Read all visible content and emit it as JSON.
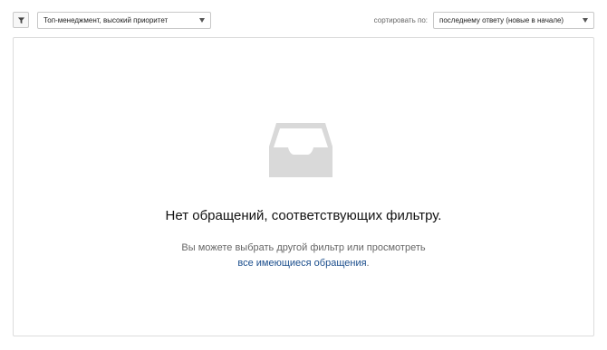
{
  "toolbar": {
    "filter_icon": "funnel-icon",
    "filter_select": {
      "value": "Топ-менеджмент, высокий приоритет"
    },
    "sort_label": "сортировать по:",
    "sort_select": {
      "value": "последнему ответу (новые в начале)"
    }
  },
  "empty_state": {
    "icon": "inbox-tray-icon",
    "title": "Нет обращений, соответствующих фильтру.",
    "text": "Вы можете выбрать другой фильтр или просмотреть",
    "link": "все имеющиеся обращения",
    "link_suffix": "."
  },
  "colors": {
    "link": "#1a4d8c",
    "icon": "#d9d9d9",
    "border": "#dcdcdc"
  }
}
